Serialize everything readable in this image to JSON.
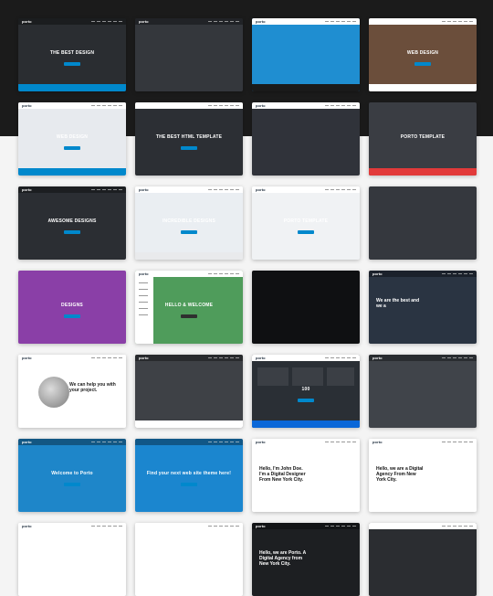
{
  "cards": [
    {
      "row": 1,
      "col": 1,
      "theme": "dark",
      "bg": "#2a2d31",
      "nav": "dark",
      "logo": "porto",
      "sub": "",
      "headline": "THE BEST DESIGN",
      "strip": "#0088cc"
    },
    {
      "row": 1,
      "col": 2,
      "theme": "dark",
      "bg": "#34373c",
      "nav": "dark",
      "logo": "porto",
      "sub": "",
      "headline": "",
      "strip": ""
    },
    {
      "row": 1,
      "col": 3,
      "theme": "blue",
      "bg": "#1f8ed1",
      "nav": "light",
      "logo": "porto",
      "sub": "",
      "headline": "",
      "strip": "#1a1a1a"
    },
    {
      "row": 1,
      "col": 4,
      "theme": "photo",
      "bg": "#6b4e3b",
      "nav": "light",
      "logo": "",
      "sub": "",
      "headline": "WEB DESIGN",
      "strip": "#ffffff"
    },
    {
      "row": 2,
      "col": 1,
      "theme": "light",
      "bg": "#e7eaee",
      "nav": "light",
      "logo": "porto",
      "sub": "",
      "headline": "WEB DESIGN",
      "strip": "#0088cc"
    },
    {
      "row": 2,
      "col": 2,
      "theme": "dark",
      "bg": "#2c2f34",
      "nav": "light",
      "logo": "",
      "sub": "",
      "headline": "THE BEST HTML TEMPLATE",
      "strip": ""
    },
    {
      "row": 2,
      "col": 3,
      "theme": "dark",
      "bg": "#30333a",
      "nav": "light",
      "logo": "porto",
      "sub": "",
      "headline": "",
      "strip": ""
    },
    {
      "row": 2,
      "col": 4,
      "theme": "dark",
      "bg": "#3a3d43",
      "nav": "",
      "logo": "",
      "sub": "",
      "headline": "PORTO TEMPLATE",
      "strip": "#e23a3a"
    },
    {
      "row": 3,
      "col": 1,
      "theme": "dark",
      "bg": "#2b2e33",
      "nav": "dark",
      "logo": "porto",
      "sub": "",
      "headline": "AWESOME DESIGNS",
      "strip": ""
    },
    {
      "row": 3,
      "col": 2,
      "theme": "light",
      "bg": "#eaeef2",
      "nav": "light",
      "logo": "porto",
      "sub": "",
      "headline": "INCREDIBLE DESIGNS",
      "strip": "#e9eaec"
    },
    {
      "row": 3,
      "col": 3,
      "theme": "light",
      "bg": "#f0f2f4",
      "nav": "light",
      "logo": "porto",
      "sub": "",
      "headline": "PORTO TEMPLATE",
      "strip": ""
    },
    {
      "row": 3,
      "col": 4,
      "theme": "dark",
      "bg": "#35383e",
      "nav": "",
      "logo": "",
      "sub": "",
      "headline": "",
      "strip": ""
    },
    {
      "row": 4,
      "col": 1,
      "theme": "purple",
      "bg": "#8a3fa7",
      "nav": "",
      "logo": "",
      "sub": "",
      "headline": "DESIGNS",
      "strip": ""
    },
    {
      "row": 4,
      "col": 2,
      "theme": "green",
      "bg": "#4f9c5b",
      "nav": "light",
      "logo": "porto",
      "sub": "",
      "headline": "HELLO & WELCOME",
      "strip": ""
    },
    {
      "row": 4,
      "col": 3,
      "theme": "black",
      "bg": "#0f1012",
      "nav": "",
      "logo": "",
      "sub": "",
      "headline": "",
      "strip": ""
    },
    {
      "row": 4,
      "col": 4,
      "theme": "dark",
      "bg": "#2a3442",
      "nav": "dark",
      "logo": "porto",
      "sub": "",
      "headline": "We are the best and we a",
      "strip": ""
    },
    {
      "row": 5,
      "col": 1,
      "theme": "white",
      "bg": "#ffffff",
      "nav": "light",
      "logo": "porto",
      "sub": "",
      "headline": "We can help you with your project.",
      "strip": ""
    },
    {
      "row": 5,
      "col": 2,
      "theme": "dark",
      "bg": "#3e4146",
      "nav": "dark",
      "logo": "porto",
      "sub": "",
      "headline": "",
      "strip": "#ffffff"
    },
    {
      "row": 5,
      "col": 3,
      "theme": "blue",
      "bg": "#2a2f35",
      "nav": "light",
      "logo": "porto",
      "sub": "",
      "headline": "100",
      "strip": "#0a67d8"
    },
    {
      "row": 5,
      "col": 4,
      "theme": "dark",
      "bg": "#40444a",
      "nav": "dark",
      "logo": "porto",
      "sub": "",
      "headline": "",
      "strip": ""
    },
    {
      "row": 6,
      "col": 1,
      "theme": "blue",
      "bg": "#1e86c9",
      "nav": "dark",
      "logo": "porto",
      "sub": "",
      "headline": "Welcome to Porto",
      "strip": ""
    },
    {
      "row": 6,
      "col": 2,
      "theme": "blue",
      "bg": "#1b86cf",
      "nav": "dark",
      "logo": "",
      "sub": "",
      "headline": "Find your next web site theme here!",
      "strip": ""
    },
    {
      "row": 6,
      "col": 3,
      "theme": "white",
      "bg": "#ffffff",
      "nav": "light",
      "logo": "porto",
      "sub": "",
      "headline": "Hello, I'm John Doe. I'm a Digital Designer From New York City.",
      "strip": ""
    },
    {
      "row": 6,
      "col": 4,
      "theme": "white",
      "bg": "#ffffff",
      "nav": "light",
      "logo": "porto",
      "sub": "",
      "headline": "Hello, we are a Digital Agency From New York City.",
      "strip": ""
    },
    {
      "row": 7,
      "col": 1,
      "theme": "white",
      "bg": "#ffffff",
      "nav": "light",
      "logo": "porto",
      "sub": "",
      "headline": "",
      "strip": ""
    },
    {
      "row": 7,
      "col": 2,
      "theme": "white",
      "bg": "#ffffff",
      "nav": "light",
      "logo": "",
      "sub": "",
      "headline": "",
      "strip": ""
    },
    {
      "row": 7,
      "col": 3,
      "theme": "dark",
      "bg": "#1d1f22",
      "nav": "dark",
      "logo": "porto",
      "sub": "",
      "headline": "Hello, we are Porto. A Digital Agency from New York City.",
      "strip": ""
    },
    {
      "row": 7,
      "col": 4,
      "theme": "dark",
      "bg": "#2b2d31",
      "nav": "light",
      "logo": "",
      "sub": "",
      "headline": "",
      "strip": ""
    }
  ]
}
